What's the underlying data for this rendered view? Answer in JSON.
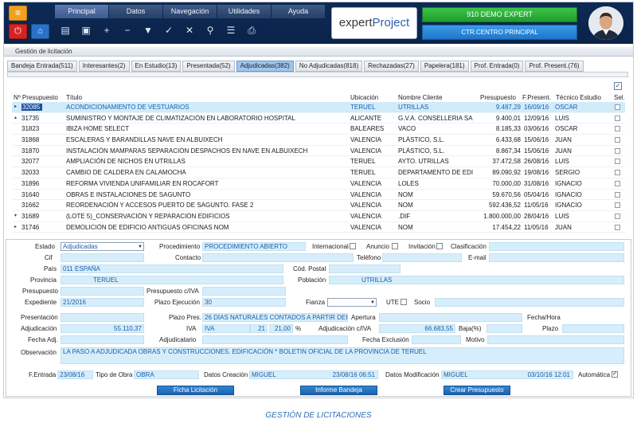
{
  "menu": [
    "Principal",
    "Datos",
    "Navegación",
    "Utilidades",
    "Ayuda"
  ],
  "logo": {
    "expert": "expert",
    "project": "Project"
  },
  "company": "910 DEMO EXPERT",
  "center": "CTR.CENTRO PRINCIPAL",
  "window_title": "Gestión de licitación",
  "tabs": [
    "Bandeja Entrada(511)",
    "Interesantes(2)",
    "En Estudio(13)",
    "Presentada(52)",
    "Adjudicadas(382)",
    "No Adjudicadas(818)",
    "Rechazadas(27)",
    "Papelera(181)",
    "Prof. Entrada(0)",
    "Prof. Present.(76)"
  ],
  "columns": {
    "num": "Nº Presupuesto",
    "titulo": "Título",
    "ubicacion": "Ubicación",
    "cliente": "Nombre Cliente",
    "presupuesto": "Presupuesto",
    "fecha": "F.Present.",
    "tecnico": "Técnico Estudio",
    "sel": "Sel."
  },
  "rows": [
    {
      "num": "32085",
      "titulo": "ACONDICIONAMIENTO DE VESTUARIOS",
      "ubicacion": "TERUEL",
      "cliente": "UTRILLAS",
      "presupuesto": "9.487,29",
      "fecha": "16/09/16",
      "tecnico": "OSCAR"
    },
    {
      "num": "31735",
      "titulo": "SUMINISTRO Y MONTAJE DE CLIMATIZACIÓN EN LABORATORIO HOSPITAL",
      "ubicacion": "ALICANTE",
      "cliente": "G.V.A. CONSELLERIA SA",
      "presupuesto": "9.400,01",
      "fecha": "12/09/16",
      "tecnico": "LUIS"
    },
    {
      "num": "31823",
      "titulo": "IBIZA HOME SELECT",
      "ubicacion": "BALEARES",
      "cliente": "VACO",
      "presupuesto": "8.185,33",
      "fecha": "03/06/16",
      "tecnico": "OSCAR"
    },
    {
      "num": "31868",
      "titulo": "ESCALERAS Y BARANDILLAS NAVE EN ALBUIXECH",
      "ubicacion": "VALENCIA",
      "cliente": "PLÁSTICO, S.L.",
      "presupuesto": "6.433,68",
      "fecha": "15/06/16",
      "tecnico": "JUAN"
    },
    {
      "num": "31870",
      "titulo": "INSTALACIÓN MAMPARAS SEPARACIÓN DESPACHOS EN NAVE EN ALBUIXECH",
      "ubicacion": "VALENCIA",
      "cliente": "PLÁSTICO, S.L.",
      "presupuesto": "8.867,34",
      "fecha": "15/06/16",
      "tecnico": "JUAN"
    },
    {
      "num": "32077",
      "titulo": "AMPLIACIÓN DE NICHOS EN UTRILLAS",
      "ubicacion": "TERUEL",
      "cliente": "AYTO. UTRILLAS",
      "presupuesto": "37.472,58",
      "fecha": "26/08/16",
      "tecnico": "LUIS"
    },
    {
      "num": "32033",
      "titulo": "CAMBIO DE CALDERA EN CALAMOCHA",
      "ubicacion": "TERUEL",
      "cliente": "DEPARTAMENTO DE EDI",
      "presupuesto": "89.090,92",
      "fecha": "19/08/16",
      "tecnico": "SERGIO"
    },
    {
      "num": "31896",
      "titulo": "REFORMA VIVIENDA UNIFAMILIAR EN ROCAFORT",
      "ubicacion": "VALENCIA",
      "cliente": "LOLES",
      "presupuesto": "70.000,00",
      "fecha": "31/08/16",
      "tecnico": "IGNACIO"
    },
    {
      "num": "31640",
      "titulo": "OBRAS E INSTALACIONES DE SAGUNTO",
      "ubicacion": "VALENCIA",
      "cliente": "NOM",
      "presupuesto": "59.670,56",
      "fecha": "05/04/16",
      "tecnico": "IGNACIO"
    },
    {
      "num": "31662",
      "titulo": "REORDENACIÓN Y ACCESOS PUERTO DE SAGUNTO. FASE 2",
      "ubicacion": "VALENCIA",
      "cliente": "NOM",
      "presupuesto": "592.436,52",
      "fecha": "11/05/16",
      "tecnico": "IGNACIO"
    },
    {
      "num": "31689",
      "titulo": "(LOTE 5)_CONSERVACIÓN Y REPARACIÓN EDIFICIOS",
      "ubicacion": "VALENCIA",
      "cliente": ".DIF",
      "presupuesto": "1.800.000,00",
      "fecha": "28/04/16",
      "tecnico": "LUIS"
    },
    {
      "num": "31746",
      "titulo": "DEMOLICIÓN DE EDIFICIO ANTIGUAS OFICINAS NOM",
      "ubicacion": "VALENCIA",
      "cliente": "NOM",
      "presupuesto": "17.454,22",
      "fecha": "11/05/16",
      "tecnico": "JUAN"
    }
  ],
  "form": {
    "estado_label": "Estado",
    "estado_value": "Adjudicadas",
    "procedimiento_label": "Procedimiento",
    "procedimiento_value": "PROCEDIMIENTO ABIERTO",
    "internacional_label": "Internacional",
    "anuncio_label": "Anuncio",
    "invitacion_label": "Invitación",
    "clasificacion_label": "Clasificación",
    "cif_label": "Cif",
    "contacto_label": "Contacto",
    "telefono_label": "Teléfono",
    "email_label": "E-mail",
    "pais_label": "País",
    "pais_value": "011  ESPAÑA",
    "cod_postal_label": "Cód. Postal",
    "provincia_label": "Provincia",
    "provincia_value": "TERUEL",
    "poblacion_label": "Población",
    "poblacion_value": "UTRILLAS",
    "presupuesto_label": "Presupuesto",
    "presupuesto_iva_label": "Presupuesto c/IVA",
    "expediente_label": "Expediente",
    "expediente_value": "21/2016",
    "plazo_ejec_label": "Plazo Ejecución",
    "plazo_ejec_value": "30",
    "fianza_label": "Fianza",
    "ute_label": "UTE",
    "socio_label": "Socio",
    "presentacion_label": "Presentación",
    "plazo_pres_label": "Plazo Pres.",
    "plazo_pres_value": "26 DÍAS NATURALES CONTADOS A PARTIR DEI",
    "apertura_label": "Apertura",
    "fecha_hora_label": "Fecha/Hora",
    "adjudicacion_label": "Adjudicación",
    "adjudicacion_value": "55.110,37",
    "iva_label": "IVA",
    "iva_value": "IVA",
    "iva_num": "21",
    "iva_pct": "21,00",
    "pct_symbol": "%",
    "adjudicacion_iva_label": "Adjudicación c/IVA",
    "adjudicacion_iva_value": "66.683,55",
    "baja_label": "Baja(%)",
    "plazo_label": "Plazo",
    "fecha_adj_label": "Fecha Adj.",
    "adjudicatario_label": "Adjudicatario",
    "fecha_exclusion_label": "Fecha Exclusión",
    "motivo_label": "Motivo",
    "observacion_label": "Observación",
    "observacion_value": "LA PASO A ADJUDICADA  OBRAS Y CONSTRUCCIONES. EDIFICACIÓN * BOLETIN OFICIAL DE LA PROVINCIA DE TERUEL",
    "fentrada_label": "F.Entrada",
    "fentrada_value": "23/08/16",
    "tipo_obra_label": "Tipo de Obra",
    "tipo_obra_value": "OBRA",
    "datos_creacion_label": "Datos Creación",
    "creacion_user": "MIGUEL",
    "creacion_date": "23/08/16 06:51",
    "datos_mod_label": "Datos Modificación",
    "mod_user": "MIGUEL",
    "mod_date": "03/10/16 12:01",
    "automatica_label": "Automática"
  },
  "buttons": {
    "ficha": "Ficha Licitación",
    "informe": "Informe Bandeja",
    "crear": "Crear Presupuesto"
  },
  "caption": "GESTIÓN DE LICITACIONES"
}
